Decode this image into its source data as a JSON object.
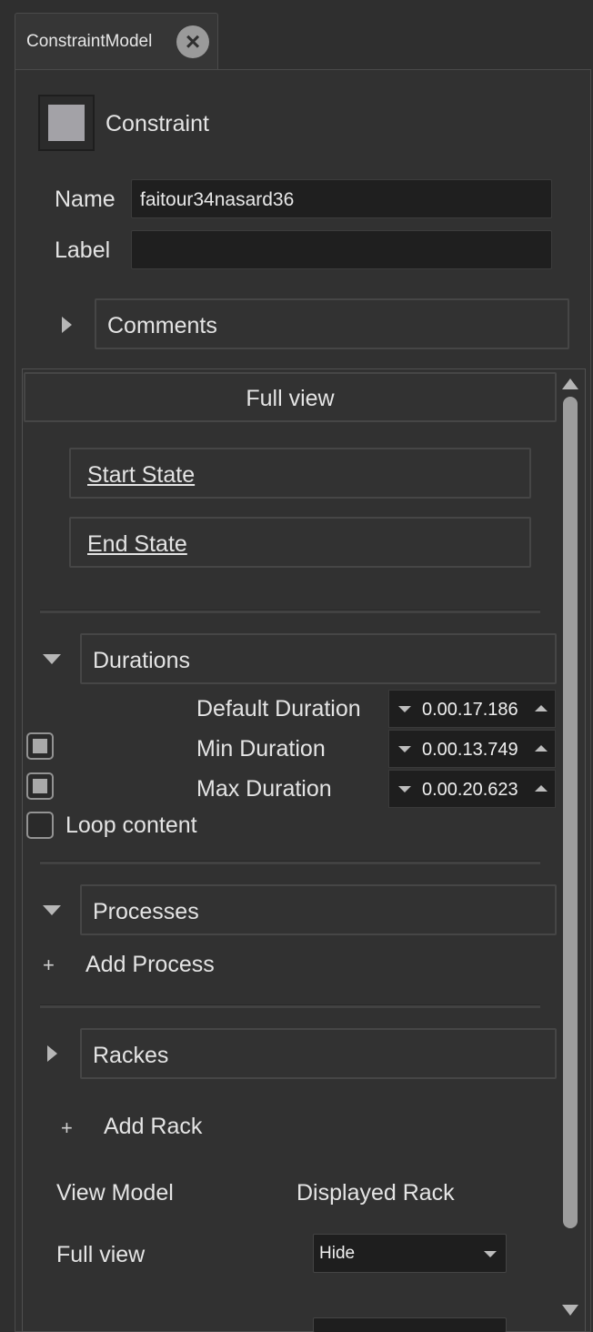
{
  "tab": {
    "title": "ConstraintModel",
    "close_icon": "close-circle-icon"
  },
  "header": {
    "title": "Constraint",
    "icon": "constraint-square-icon",
    "icon_color": "#a3a2a7"
  },
  "fields": {
    "name_label": "Name",
    "name_value": "faitour34nasard36",
    "label_label": "Label",
    "label_value": ""
  },
  "comments": {
    "label": "Comments"
  },
  "view": {
    "full_view_label": "Full view"
  },
  "states": {
    "start": "Start State",
    "end": "End State"
  },
  "durations": {
    "section_label": "Durations",
    "default_label": "Default Duration",
    "default_value": "0.00.17.186",
    "min_label": "Min Duration",
    "min_value": "0.00.13.749",
    "min_enabled": true,
    "max_label": "Max Duration",
    "max_value": "0.00.20.623",
    "max_enabled": true,
    "loop_label": "Loop content",
    "loop_enabled": false
  },
  "processes": {
    "section_label": "Processes",
    "add_label": "Add Process",
    "add_icon": "+"
  },
  "rackes": {
    "section_label": "Rackes",
    "add_label": "Add Rack",
    "add_icon": "+"
  },
  "rack_table": {
    "col_view_model": "View Model",
    "col_displayed_rack": "Displayed Rack",
    "row_view_model": "Full view",
    "row_displayed_rack": "Hide"
  },
  "colors": {
    "background": "#2f2f2f",
    "field_bg": "#1f1f1f",
    "text": "#e4e4e4"
  }
}
